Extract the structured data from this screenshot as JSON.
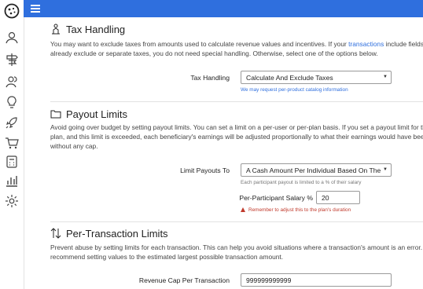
{
  "sidebar": {
    "icons": [
      "cookie-logo-icon",
      "user-icon",
      "signpost-icon",
      "users-icon",
      "lightbulb-icon",
      "rocket-icon",
      "cart-icon",
      "calculator-icon",
      "chart-icon",
      "gear-icon"
    ]
  },
  "tax": {
    "title": "Tax Handling",
    "desc_pre": "You may want to exclude taxes from amounts used to calculate revenue values and incentives. If your ",
    "desc_link": "transactions",
    "desc_post": " include fields which already exclude or separate taxes, you do not need special handling. Otherwise, select one of the options below.",
    "field_label": "Tax Handling",
    "field_value": "Calculate And Exclude Taxes",
    "help": "We may request per-product catalog information"
  },
  "payout": {
    "title": "Payout Limits",
    "desc": "Avoid going over budget by setting payout limits. You can set a limit on a per-user or per-plan basis. If you set a payout limit for the plan, and this limit is exceeded, each beneficiary's earnings will be adjusted proportionally to what their earnings would have been without any cap.",
    "limit_label": "Limit Payouts To",
    "limit_value": "A Cash Amount Per Individual Based On Thе",
    "limit_help": "Each participant payout is limited to a % of their salary",
    "salary_label": "Per-Participant Salary %",
    "salary_value": "20",
    "warning": "Remember to adjust this to the plan's duration"
  },
  "pertx": {
    "title": "Per-Transaction Limits",
    "desc": "Prevent abuse by setting limits for each transaction. This can help you avoid situations where a transaction's amount is an error. We recommend setting values to the estimated largest possible transaction amount.",
    "cap_label": "Revenue Cap Per Transaction",
    "cap_value": "999999999999"
  }
}
